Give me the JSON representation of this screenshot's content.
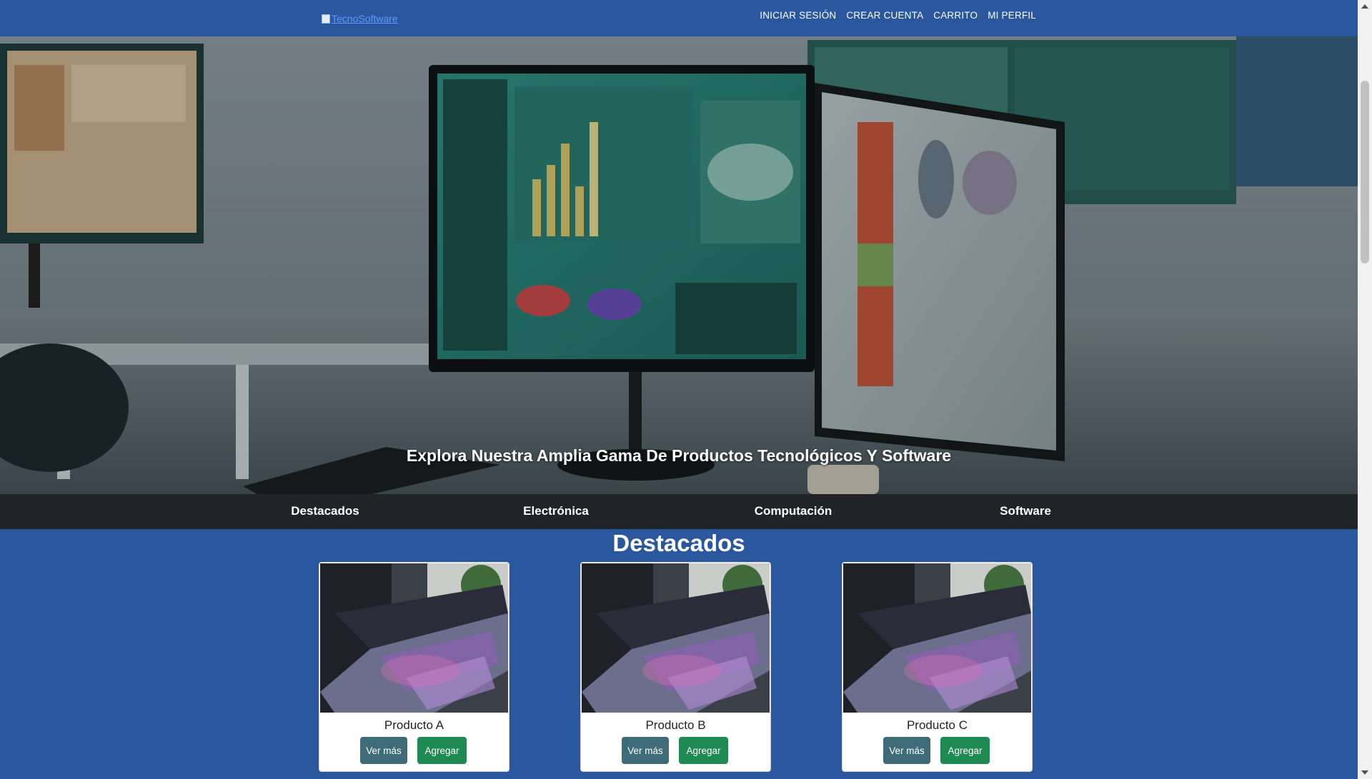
{
  "header": {
    "logo_alt": "TecnoSoftware",
    "nav": [
      "INICIAR SESIÓN",
      "CREAR CUENTA",
      "CARRITO",
      "MI PERFIL"
    ]
  },
  "hero": {
    "caption": "Explora Nuestra Amplia Gama De Productos Tecnológicos Y Software",
    "image_icon": "office-monitors-dashboard-image"
  },
  "categories": [
    "Destacados",
    "Electrónica",
    "Computación",
    "Software"
  ],
  "featured": {
    "title": "Destacados",
    "products": [
      {
        "name": "Producto A",
        "more_label": "Ver más",
        "add_label": "Agregar",
        "image_icon": "laptop-image"
      },
      {
        "name": "Producto B",
        "more_label": "Ver más",
        "add_label": "Agregar",
        "image_icon": "laptop-image"
      },
      {
        "name": "Producto C",
        "more_label": "Ver más",
        "add_label": "Agregar",
        "image_icon": "laptop-image"
      }
    ]
  },
  "colors": {
    "brand_blue": "#2a579d",
    "category_bar": "#202428",
    "btn_more": "#3e6b77",
    "btn_add": "#1e8a52"
  }
}
